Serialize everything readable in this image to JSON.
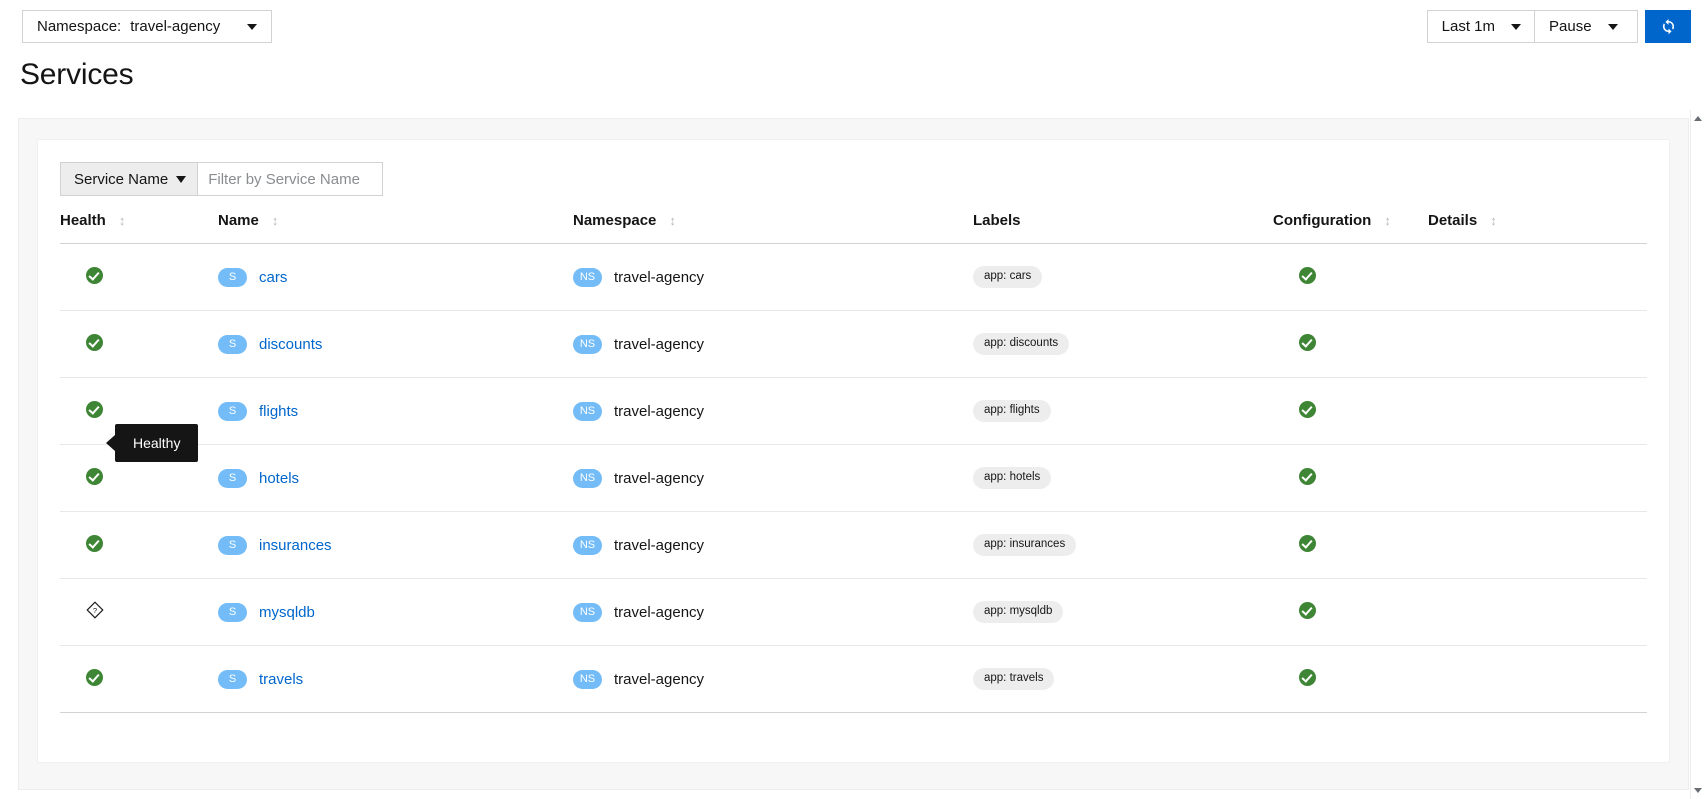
{
  "topbar": {
    "namespace_label": "Namespace:",
    "namespace_value": "travel-agency",
    "time_range": "Last 1m",
    "refresh_mode": "Pause",
    "refresh_button_icon": "refresh-icon"
  },
  "page": {
    "title": "Services"
  },
  "toolbar": {
    "filter_type": "Service Name",
    "filter_placeholder": "Filter by Service Name",
    "filter_value": ""
  },
  "table": {
    "headers": [
      {
        "label": "Health",
        "sortable": true
      },
      {
        "label": "Name",
        "sortable": true
      },
      {
        "label": "Namespace",
        "sortable": true
      },
      {
        "label": "Labels",
        "sortable": false
      },
      {
        "label": "Configuration",
        "sortable": true
      },
      {
        "label": "Details",
        "sortable": true
      }
    ],
    "rows": [
      {
        "health": "healthy",
        "badge": "S",
        "name": "cars",
        "ns_badge": "NS",
        "namespace": "travel-agency",
        "label": "app: cars",
        "configuration": "healthy",
        "details": ""
      },
      {
        "health": "healthy",
        "badge": "S",
        "name": "discounts",
        "ns_badge": "NS",
        "namespace": "travel-agency",
        "label": "app: discounts",
        "configuration": "healthy",
        "details": ""
      },
      {
        "health": "healthy",
        "badge": "S",
        "name": "flights",
        "ns_badge": "NS",
        "namespace": "travel-agency",
        "label": "app: flights",
        "configuration": "healthy",
        "details": ""
      },
      {
        "health": "healthy",
        "badge": "S",
        "name": "hotels",
        "ns_badge": "NS",
        "namespace": "travel-agency",
        "label": "app: hotels",
        "configuration": "healthy",
        "details": ""
      },
      {
        "health": "healthy",
        "badge": "S",
        "name": "insurances",
        "ns_badge": "NS",
        "namespace": "travel-agency",
        "label": "app: insurances",
        "configuration": "healthy",
        "details": ""
      },
      {
        "health": "na",
        "badge": "S",
        "name": "mysqldb",
        "ns_badge": "NS",
        "namespace": "travel-agency",
        "label": "app: mysqldb",
        "configuration": "healthy",
        "details": ""
      },
      {
        "health": "healthy",
        "badge": "S",
        "name": "travels",
        "ns_badge": "NS",
        "namespace": "travel-agency",
        "label": "app: travels",
        "configuration": "healthy",
        "details": ""
      }
    ]
  },
  "tooltip": {
    "text": "Healthy"
  },
  "colors": {
    "link": "#0066cc",
    "healthy_green": "#3e8635",
    "badge_blue": "#73bcf7",
    "primary_button": "#0066cc",
    "pill_gray": "#ededed"
  }
}
